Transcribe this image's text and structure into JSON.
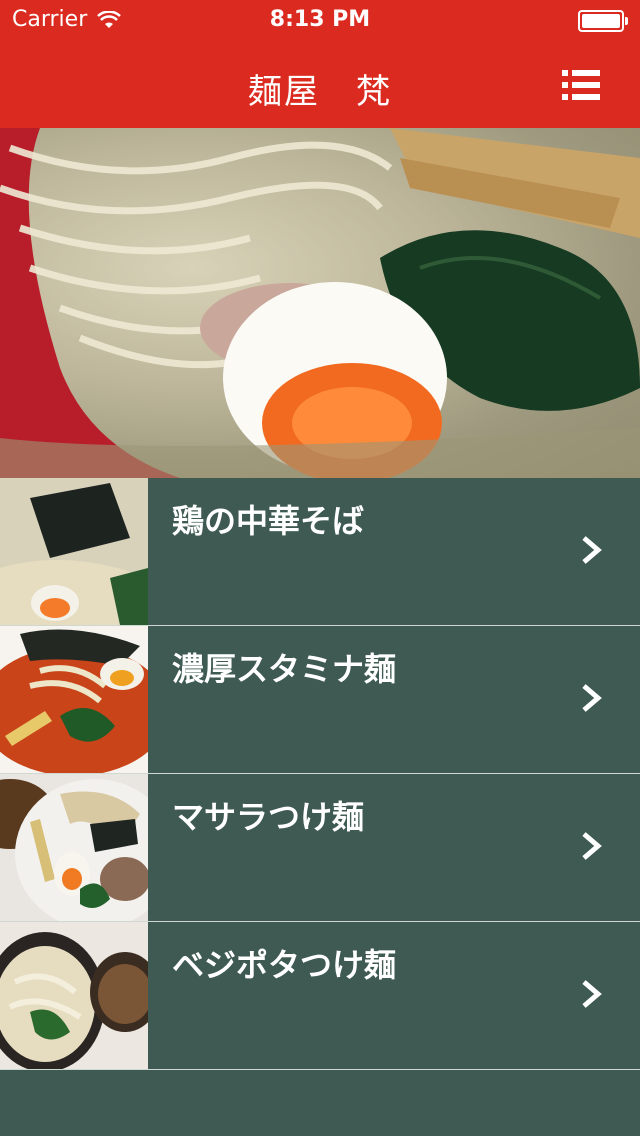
{
  "status_bar": {
    "carrier": "Carrier",
    "time": "8:13 PM"
  },
  "header": {
    "title": "麺屋　梵",
    "menu_icon": "list-icon"
  },
  "colors": {
    "header": "#db2a1f",
    "row_background": "#3e5a52",
    "separator": "#cfd8d3"
  },
  "menu_items": [
    {
      "label": "鶏の中華そば"
    },
    {
      "label": "濃厚スタミナ麺"
    },
    {
      "label": "マサラつけ麺"
    },
    {
      "label": "ベジポタつけ麺"
    }
  ]
}
